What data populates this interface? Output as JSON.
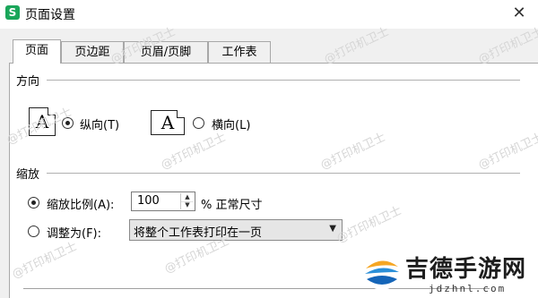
{
  "window": {
    "app_icon": "S",
    "title": "页面设置",
    "close_glyph": "✕"
  },
  "tabs": [
    {
      "label": "页面",
      "active": true
    },
    {
      "label": "页边距",
      "active": false
    },
    {
      "label": "页眉/页脚",
      "active": false
    },
    {
      "label": "工作表",
      "active": false
    }
  ],
  "orientation": {
    "group_label": "方向",
    "portrait": {
      "icon_letter": "A",
      "label": "纵向(T)",
      "checked": true
    },
    "landscape": {
      "icon_letter": "A",
      "label": "横向(L)",
      "checked": false
    }
  },
  "scaling": {
    "group_label": "缩放",
    "scale_ratio": {
      "label": "缩放比例(A):",
      "checked": true,
      "value": "100",
      "suffix": "% 正常尺寸"
    },
    "fit_to": {
      "label": "调整为(F):",
      "checked": false,
      "selected": "将整个工作表打印在一页"
    }
  },
  "watermark_text": "@打印机卫士",
  "brand": {
    "name": "吉德手游网",
    "url": "jdzhnl.com"
  }
}
